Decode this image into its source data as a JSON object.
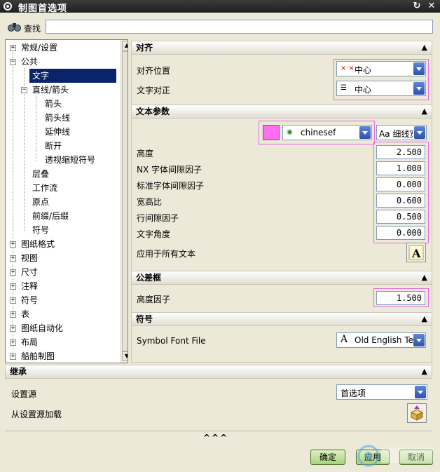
{
  "window": {
    "title": "制图首选项"
  },
  "search": {
    "label": "查找",
    "value": ""
  },
  "tree": {
    "items": [
      {
        "label": "常规/设置",
        "expander": "+"
      },
      {
        "label": "公共",
        "expander": "−"
      },
      {
        "label": "文字",
        "selected": true
      },
      {
        "label": "直线/箭头",
        "expander": "−"
      },
      {
        "label": "箭头"
      },
      {
        "label": "箭头线"
      },
      {
        "label": "延伸线"
      },
      {
        "label": "断开"
      },
      {
        "label": "透视缩短符号"
      },
      {
        "label": "层叠"
      },
      {
        "label": "工作流"
      },
      {
        "label": "原点"
      },
      {
        "label": "前缀/后缀"
      },
      {
        "label": "符号"
      },
      {
        "label": "图纸格式",
        "expander": "+"
      },
      {
        "label": "视图",
        "expander": "+"
      },
      {
        "label": "尺寸",
        "expander": "+"
      },
      {
        "label": "注释",
        "expander": "+"
      },
      {
        "label": "符号",
        "expander": "+"
      },
      {
        "label": "表",
        "expander": "+"
      },
      {
        "label": "图纸自动化",
        "expander": "+"
      },
      {
        "label": "布局",
        "expander": "+"
      },
      {
        "label": "船舶制图",
        "expander": "+"
      }
    ]
  },
  "align": {
    "header": "对齐",
    "position_label": "对齐位置",
    "position_value": "中心",
    "justify_label": "文字对正",
    "justify_value": "中心"
  },
  "text_params": {
    "header": "文本参数",
    "font_value": "chinesef",
    "width_value": "Aa 细线宽",
    "fields": [
      {
        "label": "高度",
        "value": "2.500"
      },
      {
        "label": "NX 字体间隙因子",
        "value": "1.000"
      },
      {
        "label": "标准字体间隙因子",
        "value": "0.000"
      },
      {
        "label": "宽高比",
        "value": "0.600"
      },
      {
        "label": "行间隙因子",
        "value": "0.500"
      },
      {
        "label": "文字角度",
        "value": "0.000"
      }
    ],
    "apply_all_label": "应用于所有文本",
    "swatch_color": "#ff6ef0"
  },
  "tolerance": {
    "header": "公差框",
    "height_label": "高度因子",
    "height_value": "1.500"
  },
  "symbol": {
    "header": "符号",
    "font_file_label": "Symbol Font File",
    "font_file_value": "Old English Tex"
  },
  "inherit": {
    "header": "继承",
    "source_label": "设置源",
    "source_value": "首选项",
    "load_label": "从设置源加载"
  },
  "footer": {
    "more": "^^^",
    "ok_label": "确定",
    "apply_label": "应用",
    "cancel_label": "取消"
  }
}
